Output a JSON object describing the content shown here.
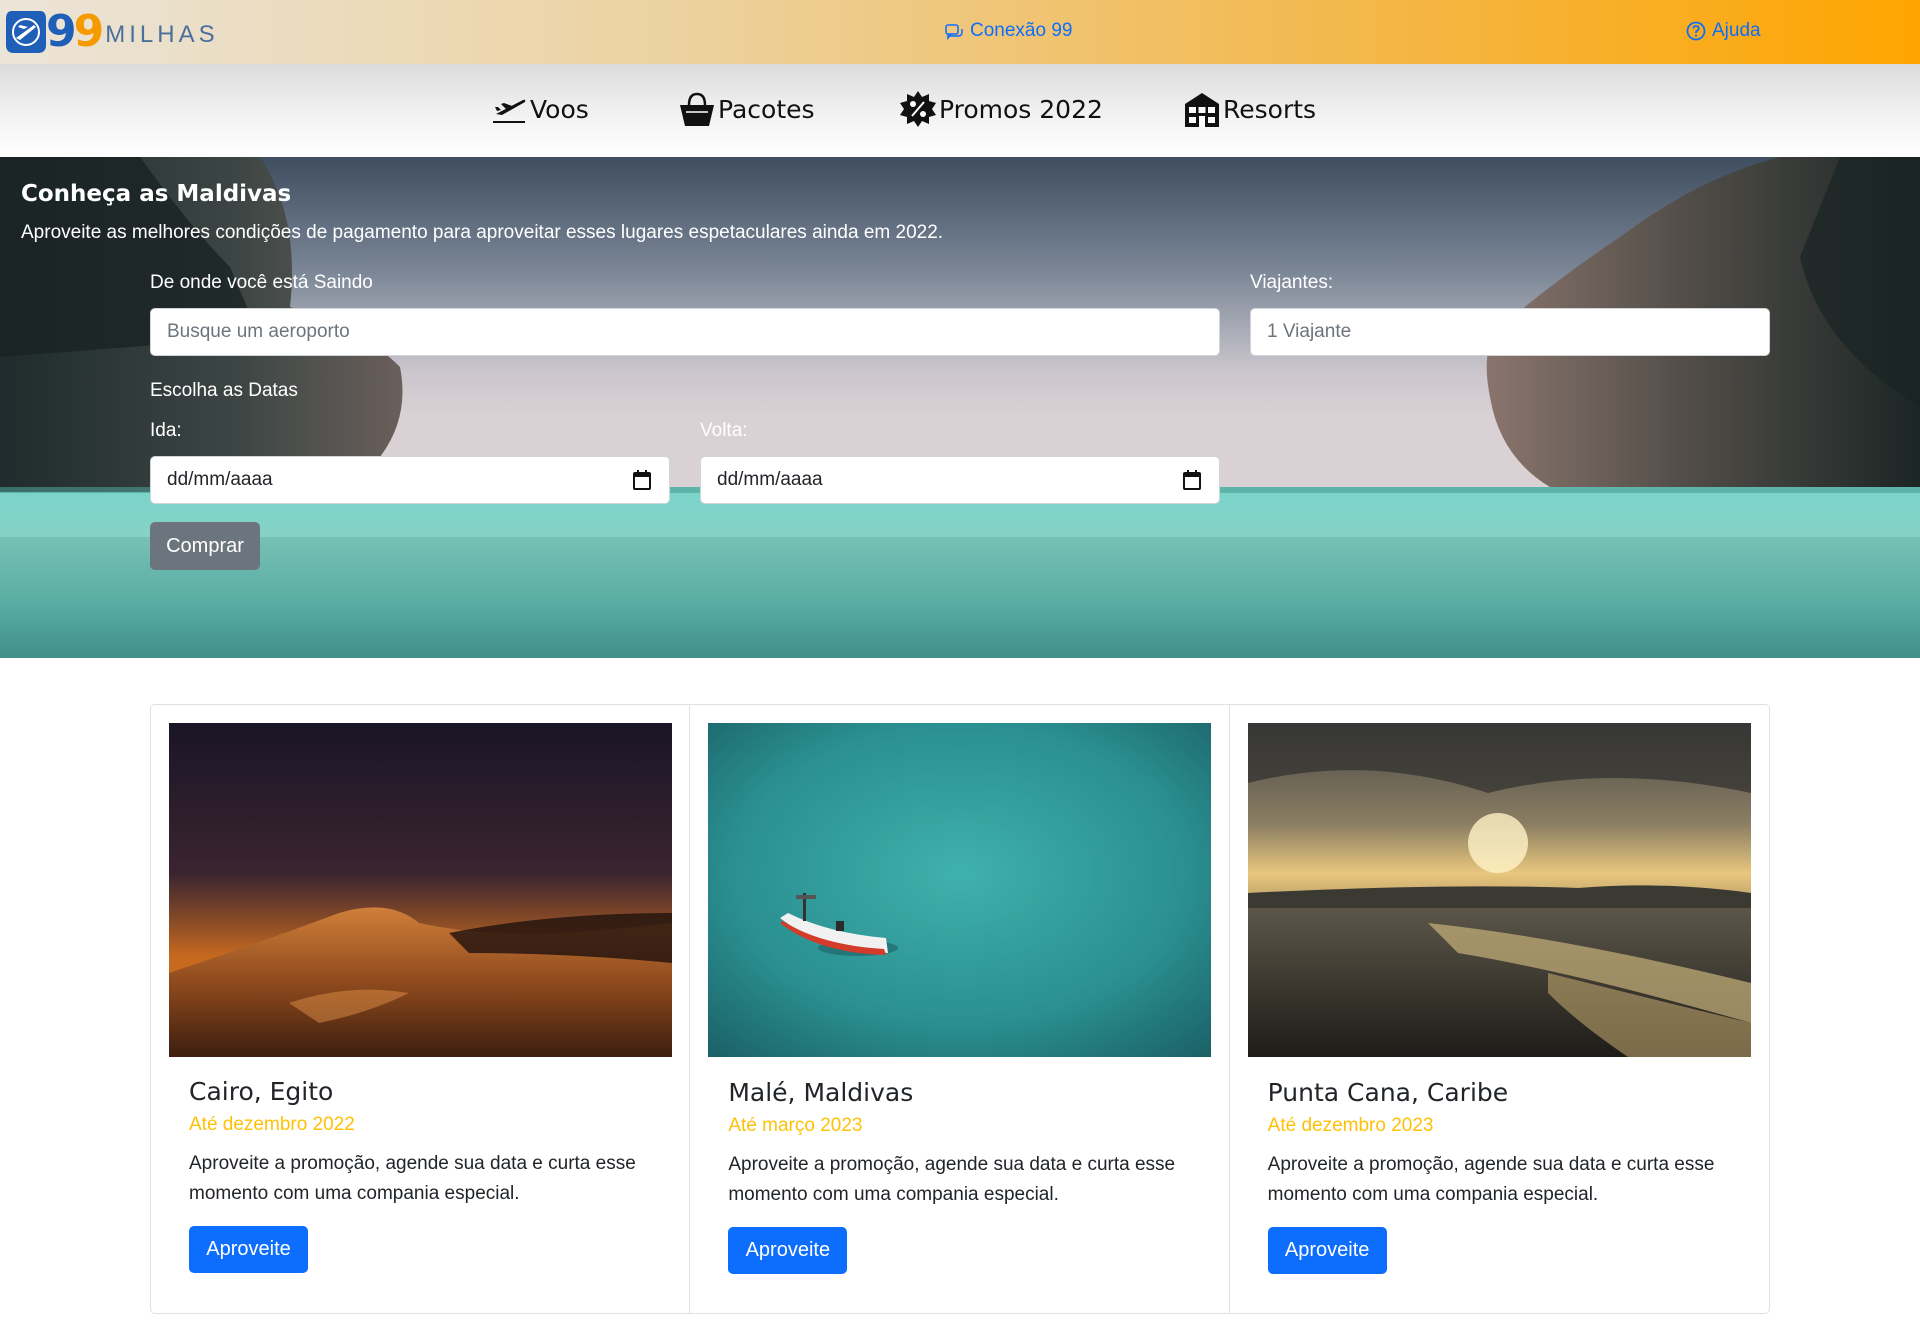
{
  "header": {
    "logo_digits": [
      "9",
      "9"
    ],
    "logo_word": "MILHAS",
    "links": [
      {
        "label": "Conexão 99",
        "icon": "chat-bubbles-icon"
      },
      {
        "label": "Ajuda",
        "icon": "question-circle-icon"
      }
    ],
    "colors": {
      "gradient_start": "#ebe4d8",
      "gradient_end": "#fea500",
      "link": "#0d6efd"
    }
  },
  "nav": {
    "items": [
      {
        "label": "Voos",
        "icon": "airplane-takeoff-icon"
      },
      {
        "label": "Pacotes",
        "icon": "shopping-bag-icon"
      },
      {
        "label": "Promos 2022",
        "icon": "discount-badge-icon"
      },
      {
        "label": "Resorts",
        "icon": "resort-building-icon"
      }
    ]
  },
  "hero": {
    "title": "Conheça as Maldivas",
    "subtitle": "Aproveite as melhores condições de pagamento para aproveitar esses lugares espetaculares ainda em 2022.",
    "form": {
      "origin_label": "De onde você está Saindo",
      "origin_placeholder": "Busque um aeroporto",
      "travelers_label": "Viajantes:",
      "travelers_placeholder": "1 Viajante",
      "dates_label": "Escolha as Datas",
      "departure_label": "Ida:",
      "departure_value": "dd/mm/aaaa",
      "return_label": "Volta:",
      "return_value": "dd/mm/aaaa",
      "submit_label": "Comprar"
    }
  },
  "cards": [
    {
      "title": "Cairo, Egito",
      "date": "Até dezembro 2022",
      "text": "Aproveite a promoção, agende sua data e curta esse momento com uma compania especial.",
      "button": "Aproveite"
    },
    {
      "title": "Malé, Maldivas",
      "date": "Até março 2023",
      "text": "Aproveite a promoção, agende sua data e curta esse momento com uma compania especial.",
      "button": "Aproveite"
    },
    {
      "title": "Punta Cana, Caribe",
      "date": "Até dezembro 2023",
      "text": "Aproveite a promoção, agende sua data e curta esse momento com uma compania especial.",
      "button": "Aproveite"
    }
  ],
  "colors": {
    "primary": "#0d6efd",
    "secondary": "#6c757d",
    "warning": "#ffc107"
  }
}
